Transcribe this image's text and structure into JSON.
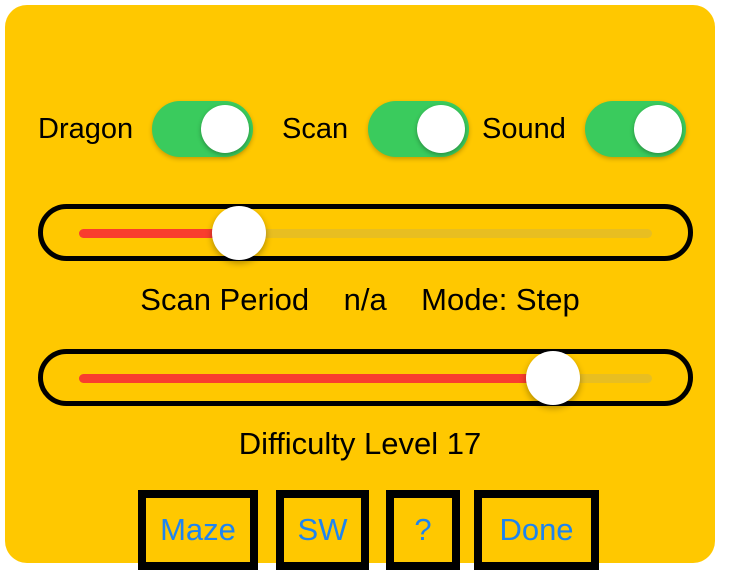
{
  "panel": {
    "background_color": "#FFC800",
    "corner_radius": 22
  },
  "toggles": [
    {
      "label": "Dragon",
      "state": "on",
      "on_color": "#3ACB5D",
      "knob_color": "#FFFFFF"
    },
    {
      "label": "Scan",
      "state": "on",
      "on_color": "#3ACB5D",
      "knob_color": "#FFFFFF"
    },
    {
      "label": "Sound",
      "state": "on",
      "on_color": "#3ACB5D",
      "knob_color": "#FFFFFF"
    }
  ],
  "sliders": [
    {
      "name": "scan-period-slider",
      "fill_percent": 24,
      "fill_color": "#F93D2E",
      "remainder_color": "#E8BE21",
      "knob_color": "#FFFFFF",
      "frame_color": "#000000"
    },
    {
      "name": "difficulty-slider",
      "fill_percent": 86,
      "fill_color": "#F93D2E",
      "remainder_color": "#E8BE21",
      "knob_color": "#FFFFFF",
      "frame_color": "#000000"
    }
  ],
  "captions": {
    "scan_period_label": "Scan Period",
    "scan_period_value": "n/a",
    "mode_label": "Mode: Step",
    "scan_period_line": "Scan Period    n/a    Mode: Step",
    "difficulty_line": "Difficulty Level 17",
    "difficulty_label": "Difficulty Level",
    "difficulty_value": "17"
  },
  "buttons": [
    {
      "label": "Maze",
      "text_color": "#1E84F0",
      "border_color": "#000000"
    },
    {
      "label": "SW",
      "text_color": "#1E84F0",
      "border_color": "#000000"
    },
    {
      "label": "?",
      "text_color": "#1E84F0",
      "border_color": "#000000"
    },
    {
      "label": "Done",
      "text_color": "#1E84F0",
      "border_color": "#000000"
    }
  ]
}
